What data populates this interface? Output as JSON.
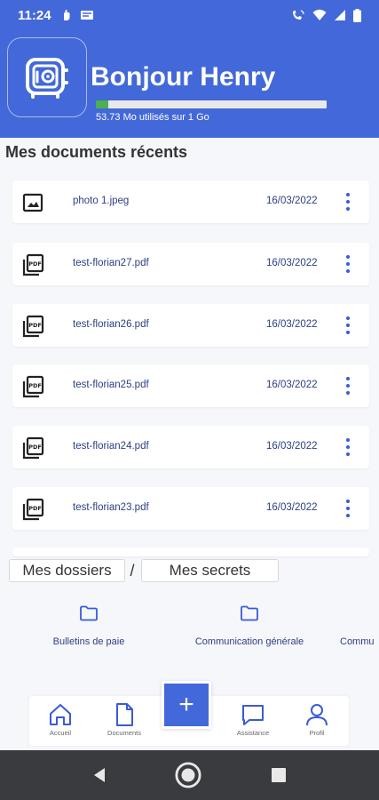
{
  "status_bar": {
    "time": "11:24",
    "icons": [
      "hand-gesture-icon",
      "message-icon",
      "wifi-calling-icon",
      "wifi-icon",
      "signal-icon",
      "battery-icon"
    ]
  },
  "header": {
    "greeting": "Bonjour Henry",
    "storage_text": "53.73 Mo utilisés sur 1 Go",
    "storage_used_fraction": 0.0526,
    "brand_color": "#4368d9"
  },
  "recent": {
    "title": "Mes documents récents",
    "documents": [
      {
        "name": "photo 1.jpeg",
        "date": "16/03/2022",
        "icon": "image-icon"
      },
      {
        "name": "test-florian27.pdf",
        "date": "16/03/2022",
        "icon": "pdf-icon"
      },
      {
        "name": "test-florian26.pdf",
        "date": "16/03/2022",
        "icon": "pdf-icon"
      },
      {
        "name": "test-florian25.pdf",
        "date": "16/03/2022",
        "icon": "pdf-icon"
      },
      {
        "name": "test-florian24.pdf",
        "date": "16/03/2022",
        "icon": "pdf-icon"
      },
      {
        "name": "test-florian23.pdf",
        "date": "16/03/2022",
        "icon": "pdf-icon"
      }
    ]
  },
  "tabs": {
    "folders": "Mes dossiers",
    "separator": "/",
    "secrets": "Mes secrets"
  },
  "folders": [
    {
      "label": "Bulletins de paie"
    },
    {
      "label": "Communication générale"
    },
    {
      "label": "Commu"
    }
  ],
  "bottom_nav": {
    "home": "Accueil",
    "documents": "Documents",
    "add": "+",
    "assistance": "Assistance",
    "profile": "Profil"
  }
}
